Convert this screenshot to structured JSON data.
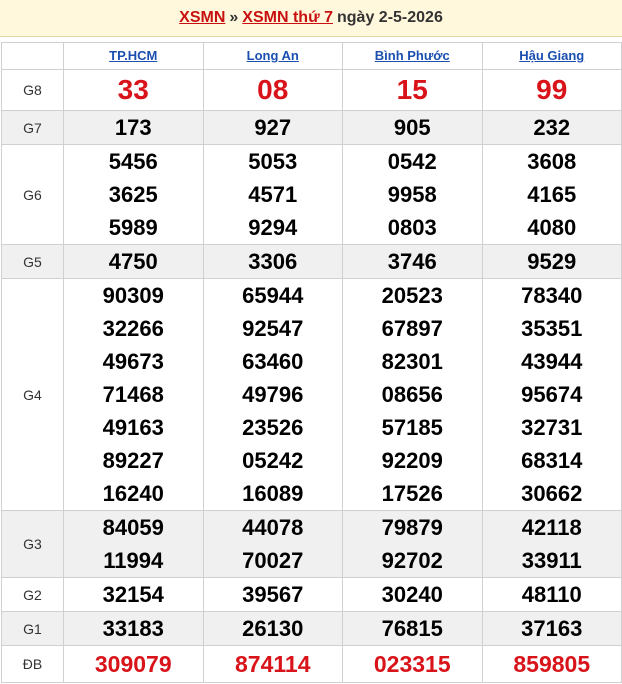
{
  "header": {
    "link1": "XSMN",
    "sep": "»",
    "link2": "XSMN thứ 7",
    "date_text": "ngày 2-5-2026"
  },
  "provinces": [
    "TP.HCM",
    "Long An",
    "Bình Phước",
    "Hậu Giang"
  ],
  "rows": [
    {
      "label": "G8",
      "values": [
        [
          "33"
        ],
        [
          "08"
        ],
        [
          "15"
        ],
        [
          "99"
        ]
      ]
    },
    {
      "label": "G7",
      "values": [
        [
          "173"
        ],
        [
          "927"
        ],
        [
          "905"
        ],
        [
          "232"
        ]
      ]
    },
    {
      "label": "G6",
      "values": [
        [
          "5456",
          "3625",
          "5989"
        ],
        [
          "5053",
          "4571",
          "9294"
        ],
        [
          "0542",
          "9958",
          "0803"
        ],
        [
          "3608",
          "4165",
          "4080"
        ]
      ]
    },
    {
      "label": "G5",
      "values": [
        [
          "4750"
        ],
        [
          "3306"
        ],
        [
          "3746"
        ],
        [
          "9529"
        ]
      ]
    },
    {
      "label": "G4",
      "values": [
        [
          "90309",
          "32266",
          "49673",
          "71468",
          "49163",
          "89227",
          "16240"
        ],
        [
          "65944",
          "92547",
          "63460",
          "49796",
          "23526",
          "05242",
          "16089"
        ],
        [
          "20523",
          "67897",
          "82301",
          "08656",
          "57185",
          "92209",
          "17526"
        ],
        [
          "78340",
          "35351",
          "43944",
          "95674",
          "32731",
          "68314",
          "30662"
        ]
      ]
    },
    {
      "label": "G3",
      "values": [
        [
          "84059",
          "11994"
        ],
        [
          "44078",
          "70027"
        ],
        [
          "79879",
          "92702"
        ],
        [
          "42118",
          "33911"
        ]
      ]
    },
    {
      "label": "G2",
      "values": [
        [
          "32154"
        ],
        [
          "39567"
        ],
        [
          "30240"
        ],
        [
          "48110"
        ]
      ]
    },
    {
      "label": "G1",
      "values": [
        [
          "33183"
        ],
        [
          "26130"
        ],
        [
          "76815"
        ],
        [
          "37163"
        ]
      ]
    },
    {
      "label": "ĐB",
      "values": [
        [
          "309079"
        ],
        [
          "874114"
        ],
        [
          "023315"
        ],
        [
          "859805"
        ]
      ]
    }
  ],
  "colors": {
    "red": "#d8141a",
    "link": "#1a4fb0",
    "title_bg": "#fff8dc"
  }
}
